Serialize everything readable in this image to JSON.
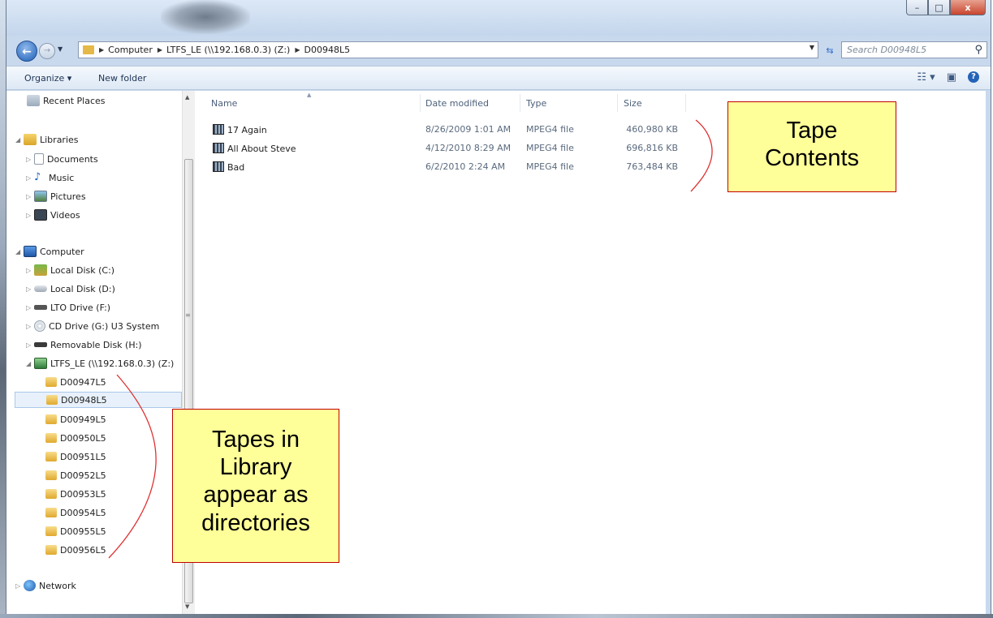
{
  "window": {
    "controls": {
      "minimize": "–",
      "maximize": "□",
      "close": "x"
    }
  },
  "address": {
    "crumbs": [
      "Computer",
      "LTFS_LE (\\\\192.168.0.3) (Z:)",
      "D00948L5"
    ],
    "search_placeholder": "Search D00948L5"
  },
  "toolbar": {
    "organize": "Organize ▾",
    "new_folder": "New folder"
  },
  "nav": {
    "recent_places": "Recent Places",
    "libraries": "Libraries",
    "documents": "Documents",
    "music": "Music",
    "pictures": "Pictures",
    "videos": "Videos",
    "computer": "Computer",
    "drives": [
      "Local Disk (C:)",
      "Local Disk (D:)",
      "LTO Drive (F:)",
      "CD Drive (G:) U3 System",
      "Removable Disk (H:)",
      "LTFS_LE (\\\\192.168.0.3) (Z:)"
    ],
    "tapes": [
      "D00947L5",
      "D00948L5",
      "D00949L5",
      "D00950L5",
      "D00951L5",
      "D00952L5",
      "D00953L5",
      "D00954L5",
      "D00955L5",
      "D00956L5"
    ],
    "selected_tape": "D00948L5",
    "network": "Network"
  },
  "columns": {
    "name": "Name",
    "date": "Date modified",
    "type": "Type",
    "size": "Size"
  },
  "files": [
    {
      "name": "17 Again",
      "date": "8/26/2009 1:01 AM",
      "type": "MPEG4 file",
      "size": "460,980 KB"
    },
    {
      "name": "All About Steve",
      "date": "4/12/2010 8:29 AM",
      "type": "MPEG4 file",
      "size": "696,816 KB"
    },
    {
      "name": "Bad",
      "date": "6/2/2010 2:24 AM",
      "type": "MPEG4 file",
      "size": "763,484 KB"
    }
  ],
  "callouts": {
    "tape_contents": [
      "Tape",
      "Contents"
    ],
    "tapes_in_library": [
      "Tapes in",
      "Library",
      "appear as",
      "directories"
    ]
  },
  "colors": {
    "callout_fill": "#ffff99",
    "callout_border": "#c00000",
    "annotation_line": "#e03030",
    "selection": "#e8f1fb"
  }
}
